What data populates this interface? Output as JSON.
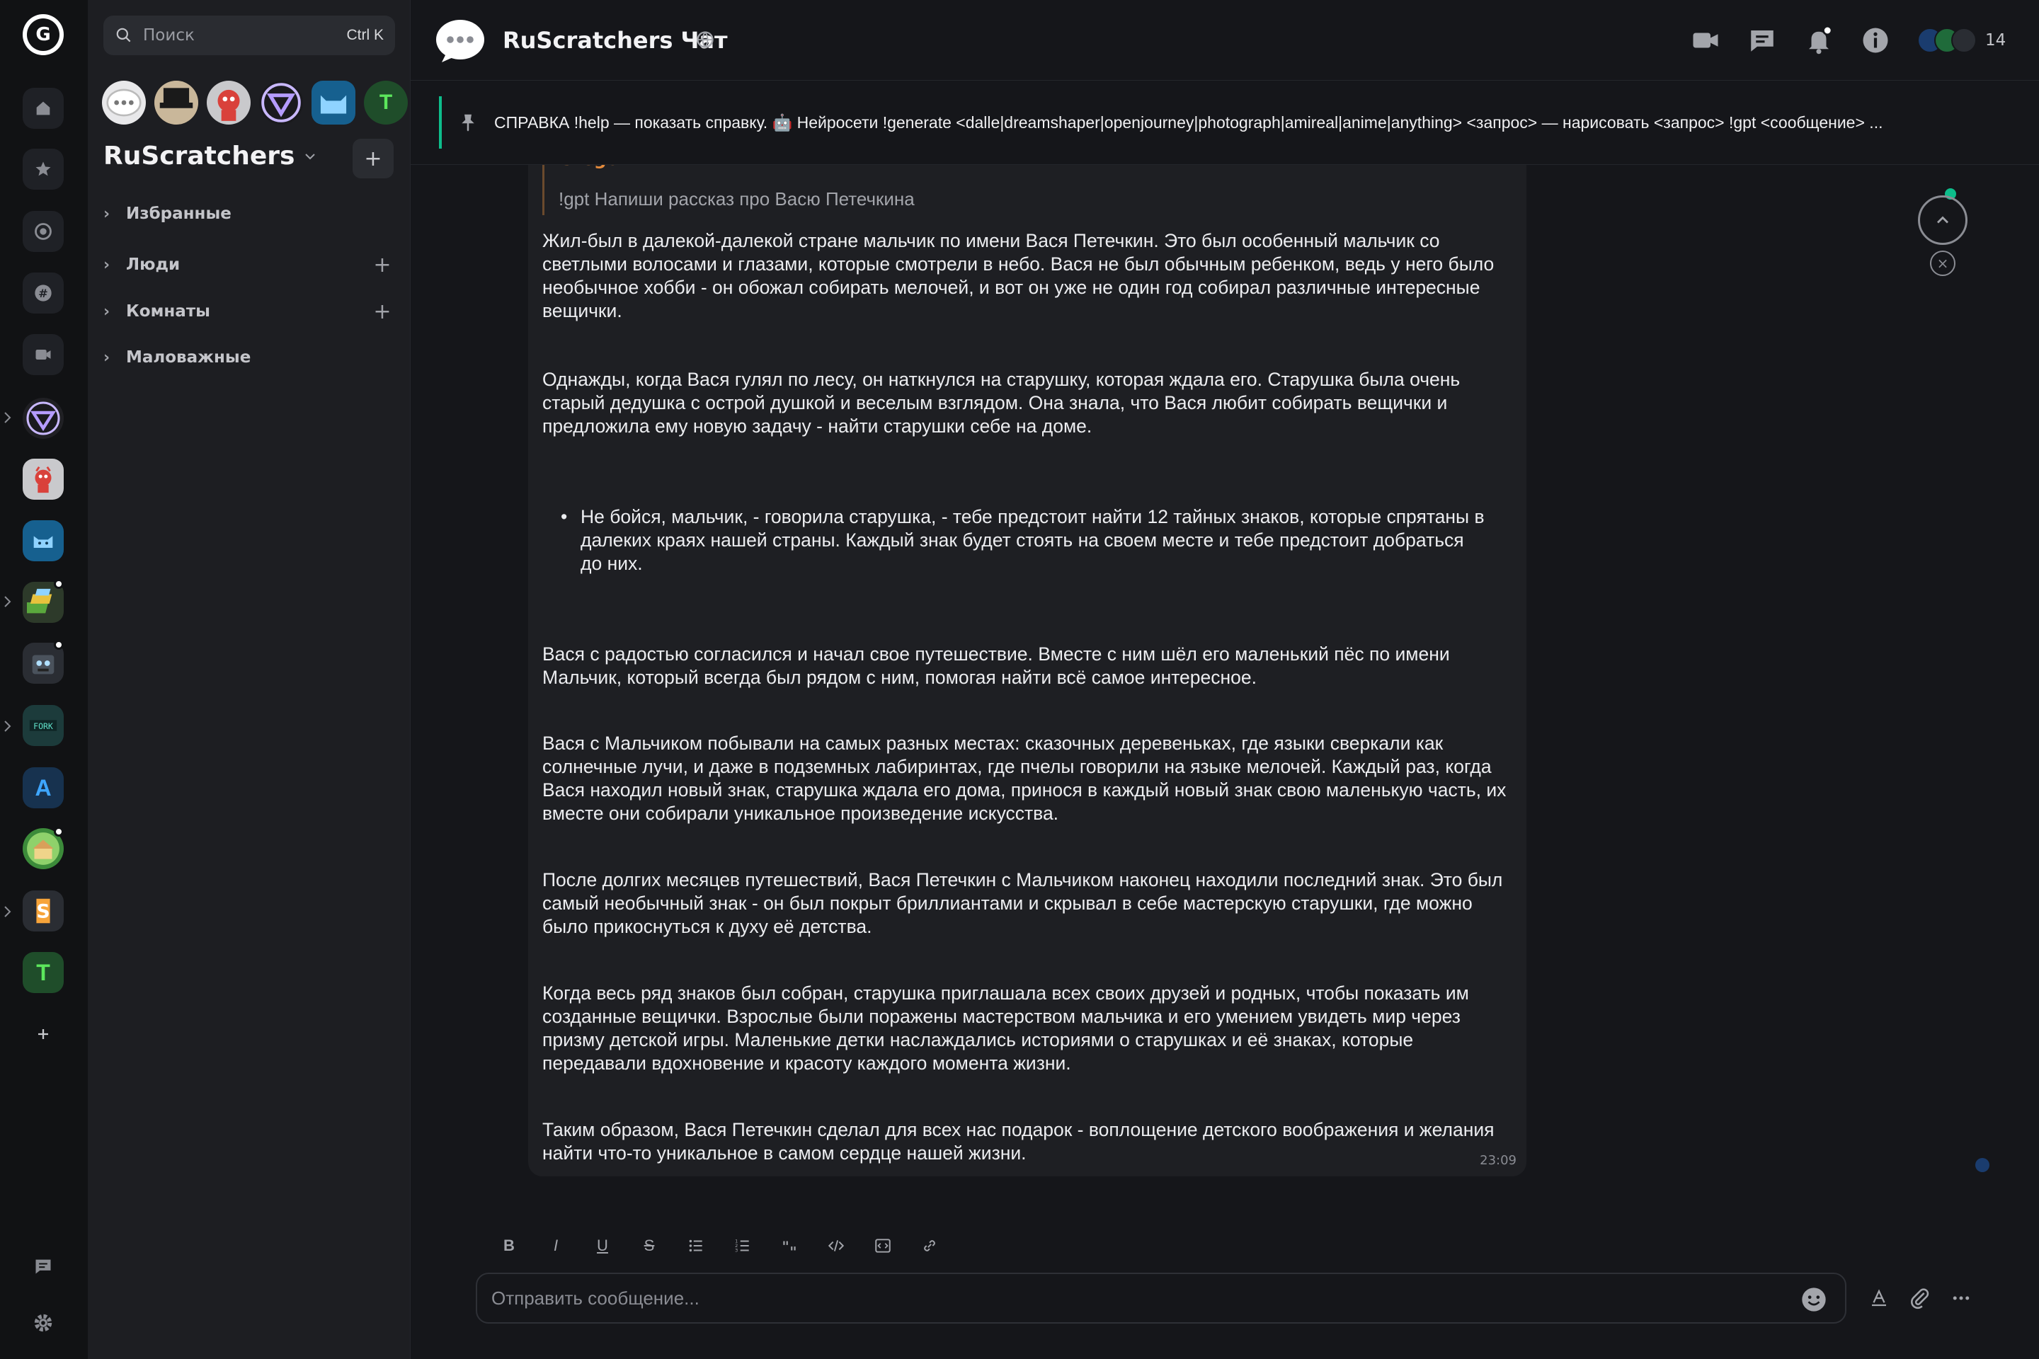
{
  "theme": {
    "accent": "#0dbd8b",
    "bg": "#15161a",
    "sidebar_bg": "#1d1e22",
    "rail_bg": "#111214"
  },
  "rail": {
    "logo_letter": "G",
    "t_space_letter": "T",
    "a_space_letter": "A"
  },
  "sidebar": {
    "search_placeholder": "Поиск",
    "search_shortcut": "Ctrl K",
    "t_avatar_letter": "T",
    "space_title": "RuScratchers",
    "sections": [
      {
        "label": "Избранные",
        "has_add": false
      },
      {
        "label": "Люди",
        "has_add": true
      },
      {
        "label": "Комнаты",
        "has_add": true
      },
      {
        "label": "Маловажные",
        "has_add": false
      }
    ]
  },
  "header": {
    "room_name": "RuScratchers Чат",
    "member_count": "14"
  },
  "pinned": {
    "text": "СПРАВКА !help — показать справку. 🤖 Нейросети !generate <dalle|dreamshaper|openjourney|photograph|amireal|anime|anything> <запрос> — нарисовать <запрос> !gpt <сообщение> ..."
  },
  "message": {
    "reply_author": "Gregon",
    "reply_text": "!gpt Напиши рассказ про Васю Петечкина",
    "time": "23:09",
    "paragraphs": [
      "Жил-был в далекой-далекой стране мальчик по имени Вася Петечкин. Это был особенный мальчик со светлыми волосами и глазами, которые смотрели в небо. Вася не был обычным ребенком, ведь у него было необычное хобби - он обожал собирать мелочей, и вот он уже не один год собирал различные интересные вещички.",
      "Однажды, когда Вася гулял по лесу, он наткнулся на старушку, которая ждала его. Старушка была очень старый дедушка с острой душкой и веселым взглядом. Она знала, что Вася любит собирать вещички и предложила ему новую задачу - найти старушки себе на доме.",
      "Не бойся, мальчик, - говорила старушка, - тебе предстоит найти 12 тайных знаков, которые спрятаны в далеких краях нашей страны. Каждый знак будет стоять на своем месте и тебе предстоит добраться до них.",
      "Вася с радостью согласился и начал свое путешествие. Вместе с ним шёл его маленький пёс по имени Мальчик, который всегда был рядом с ним, помогая найти всё самое интересное.",
      "Вася с Мальчиком побывали на самых разных местах: сказочных деревеньках, где языки сверкали как солнечные лучи, и даже в подземных лабиринтах, где пчелы говорили на языке мелочей. Каждый раз, когда Вася находил новый знак, старушка ждала его дома, принося в каждый новый знак свою маленькую часть, их вместе они собирали уникальное произведение искусства.",
      "После долгих месяцев путешествий, Вася Петечкин с Мальчиком наконец находили последний знак. Это был самый необычный знак - он был покрыт бриллиантами и скрывал в себе мастерскую старушки, где можно было прикоснуться к духу её детства.",
      "Когда весь ряд знаков был собран, старушка приглашала всех своих друзей и родных, чтобы показать им созданные вещички. Взрослые были поражены мастерством мальчика и его умением увидеть мир через призму детской игры. Маленькие детки наслаждались историями о старушках и её знаках, которые передавали вдохновение и красоту каждого момента жизни.",
      "Таким образом, Вася Петечкин сделал для всех нас подарок - воплощение детского воображения и желания найти что-то уникальное в самом сердце нашей жизни."
    ]
  },
  "composer": {
    "placeholder": "Отправить сообщение...",
    "format_buttons": [
      "B",
      "I",
      "U",
      "S",
      "bullet-list",
      "numbered-list",
      "quote",
      "inline-code",
      "code-block",
      "link"
    ]
  }
}
